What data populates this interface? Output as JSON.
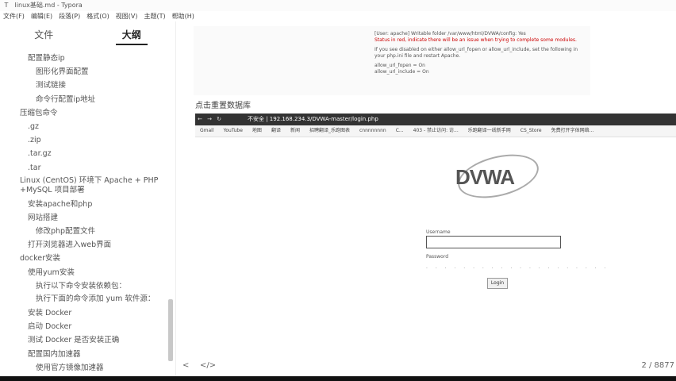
{
  "window": {
    "title": "linux基础.md - Typora",
    "app_icon": "T"
  },
  "menu": [
    "文件(F)",
    "编辑(E)",
    "段落(P)",
    "格式(O)",
    "视图(V)",
    "主题(T)",
    "帮助(H)"
  ],
  "sidebar": {
    "tabs": [
      {
        "label": "文件"
      },
      {
        "label": "大纲"
      }
    ],
    "outline": [
      {
        "label": "配置静态ip",
        "level": 2
      },
      {
        "label": "图形化界面配置",
        "level": 3
      },
      {
        "label": "测试链接",
        "level": 3
      },
      {
        "label": "命令行配置ip地址",
        "level": 3
      },
      {
        "label": "压缩包命令",
        "level": 1
      },
      {
        "label": ".gz",
        "level": 2
      },
      {
        "label": ".zip",
        "level": 2
      },
      {
        "label": ".tar.gz",
        "level": 2
      },
      {
        "label": ".tar",
        "level": 2
      },
      {
        "label": "Linux (CentOS) 环境下 Apache + PHP +MySQL 项目部署",
        "level": 1
      },
      {
        "label": "安装apache和php",
        "level": 2
      },
      {
        "label": "网站搭建",
        "level": 2
      },
      {
        "label": "修改php配置文件",
        "level": 3
      },
      {
        "label": "打开浏览器进入web界面",
        "level": 2
      },
      {
        "label": "docker安装",
        "level": 1
      },
      {
        "label": "使用yum安装",
        "level": 2
      },
      {
        "label": "执行以下命令安装依赖包：",
        "level": 3
      },
      {
        "label": "执行下面的命令添加 yum 软件源：",
        "level": 3
      },
      {
        "label": "安装 Docker",
        "level": 2
      },
      {
        "label": "启动 Docker",
        "level": 2
      },
      {
        "label": "测试 Docker 是否安装正确",
        "level": 2
      },
      {
        "label": "配置国内加速器",
        "level": 2
      },
      {
        "label": "使用官方镜像加速器",
        "level": 3
      }
    ]
  },
  "content": {
    "img1_lines": [
      "[User: apache] Writable folder /var/www/html/DVWA/config: Yes",
      "Status in red, indicate there will be an issue when trying to complete some modules.",
      "If you see disabled on either allow_url_fopen or allow_url_include, set the following in your php.ini file and restart Apache.",
      "allow_url_fopen = On",
      "allow_url_include = On"
    ],
    "caption": "点击重置数据库",
    "browser": {
      "url": "不安全 | 192.168.234.3/DVWA-master/login.php",
      "bookmarks": [
        "Gmail",
        "YouTube",
        "地图",
        "翻译",
        "新闻",
        "招聘翻译_乐跑图表",
        "cnnnnnnnn",
        "C...",
        "403 - 禁止访问: 访...",
        "乐跑翻译一线新手网",
        "CS_Store",
        "免费打开字体网络..."
      ]
    },
    "dvwa": {
      "logo": "DVWA",
      "username_label": "Username",
      "password_label": "Password",
      "password_mask": "· · · · · · · · · · · · · · · · · · · ·",
      "login_label": "Login"
    }
  },
  "status": {
    "left_icon": "<",
    "code_icon": "</>",
    "count": "2 / 8877"
  }
}
